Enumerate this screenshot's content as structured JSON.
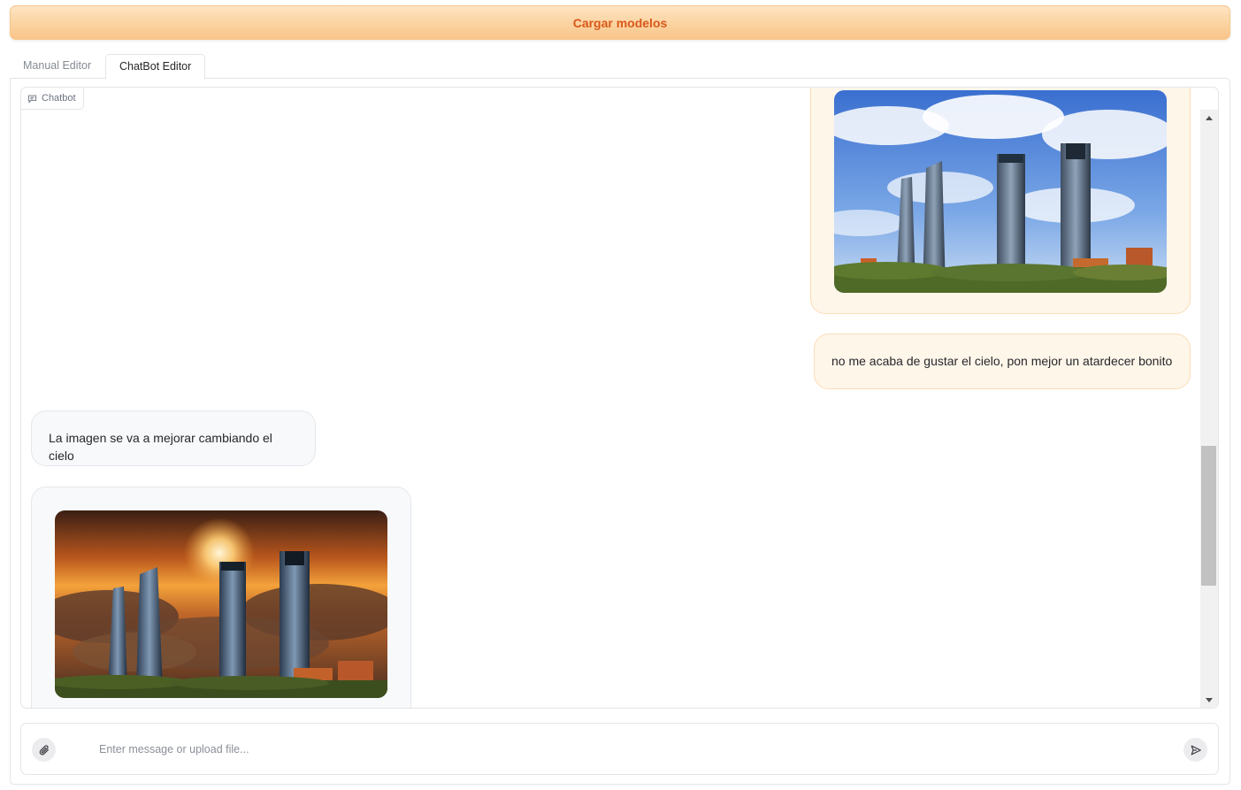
{
  "header": {
    "load_models_label": "Cargar modelos"
  },
  "tabs": [
    {
      "label": "Manual Editor",
      "selected": false
    },
    {
      "label": "ChatBot Editor",
      "selected": true
    }
  ],
  "chatbot": {
    "label": "Chatbot",
    "label_icon": "chat-bubble-icon",
    "messages": [
      {
        "role": "user",
        "type": "image",
        "description_icon": "skyline-blue-sky-image"
      },
      {
        "role": "user",
        "type": "text",
        "text": "no me acaba de gustar el cielo, pon mejor un atardecer bonito"
      },
      {
        "role": "bot",
        "type": "text",
        "text": "La imagen se va a mejorar cambiando el cielo"
      },
      {
        "role": "bot",
        "type": "image",
        "description_icon": "skyline-sunset-image"
      }
    ]
  },
  "input": {
    "placeholder": "Enter message or upload file...",
    "value": "",
    "attach_icon": "paperclip-icon",
    "send_icon": "send-icon"
  },
  "colors": {
    "accent": "#d8591b",
    "button_gradient_top": "#fee4c3",
    "button_gradient_bottom": "#f9c58a",
    "user_bubble_bg": "#fff6ea",
    "user_bubble_border": "#fcdcb4",
    "bot_bubble_bg": "#f8f9fb"
  }
}
